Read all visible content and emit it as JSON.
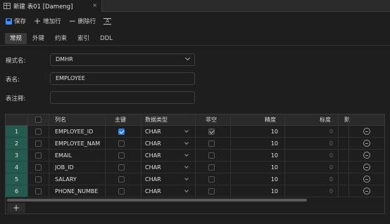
{
  "tab": {
    "title": "新建 表01 [Dameng]",
    "close": "×"
  },
  "toolbar": {
    "save": "保存",
    "add_row": "增加行",
    "delete_row": "删除行",
    "format_glyph": "A"
  },
  "subtabs": [
    "常规",
    "外键",
    "约束",
    "索引",
    "DDL"
  ],
  "form": {
    "schema_label": "模式名:",
    "schema_value": "DMHR",
    "table_label": "表名:",
    "table_value": "EMPLOYEE",
    "comment_label": "表注释:",
    "comment_value": ""
  },
  "grid": {
    "headers": {
      "name": "列名",
      "pk": "主键",
      "type": "数据类型",
      "notnull": "非空",
      "precision": "精度",
      "scale": "标度",
      "default": "默"
    },
    "rows": [
      {
        "num": "1",
        "name": "EMPLOYEE_ID",
        "pk": true,
        "type": "CHAR",
        "notnull": true,
        "precision": "10",
        "scale": "0"
      },
      {
        "num": "2",
        "name": "EMPLOYEE_NAM",
        "pk": false,
        "type": "CHAR",
        "notnull": false,
        "precision": "10",
        "scale": "0"
      },
      {
        "num": "3",
        "name": "EMAIL",
        "pk": false,
        "type": "CHAR",
        "notnull": false,
        "precision": "10",
        "scale": "0"
      },
      {
        "num": "4",
        "name": "JOB_ID",
        "pk": false,
        "type": "CHAR",
        "notnull": false,
        "precision": "10",
        "scale": "0"
      },
      {
        "num": "5",
        "name": "SALARY",
        "pk": false,
        "type": "CHAR",
        "notnull": false,
        "precision": "10",
        "scale": "0"
      },
      {
        "num": "6",
        "name": "PHONE_NUMBE",
        "pk": false,
        "type": "CHAR",
        "notnull": false,
        "precision": "10",
        "scale": "0"
      }
    ],
    "add_button": "+"
  },
  "icons": {
    "save": "save-icon",
    "add": "plus-icon",
    "delete": "minus-icon",
    "format": "format-icon",
    "remove_row": "minus-circle-icon"
  },
  "colors": {
    "accent": "#2f80ed",
    "rownum_bg": "#245b4e",
    "background": "#1e1e1e"
  }
}
